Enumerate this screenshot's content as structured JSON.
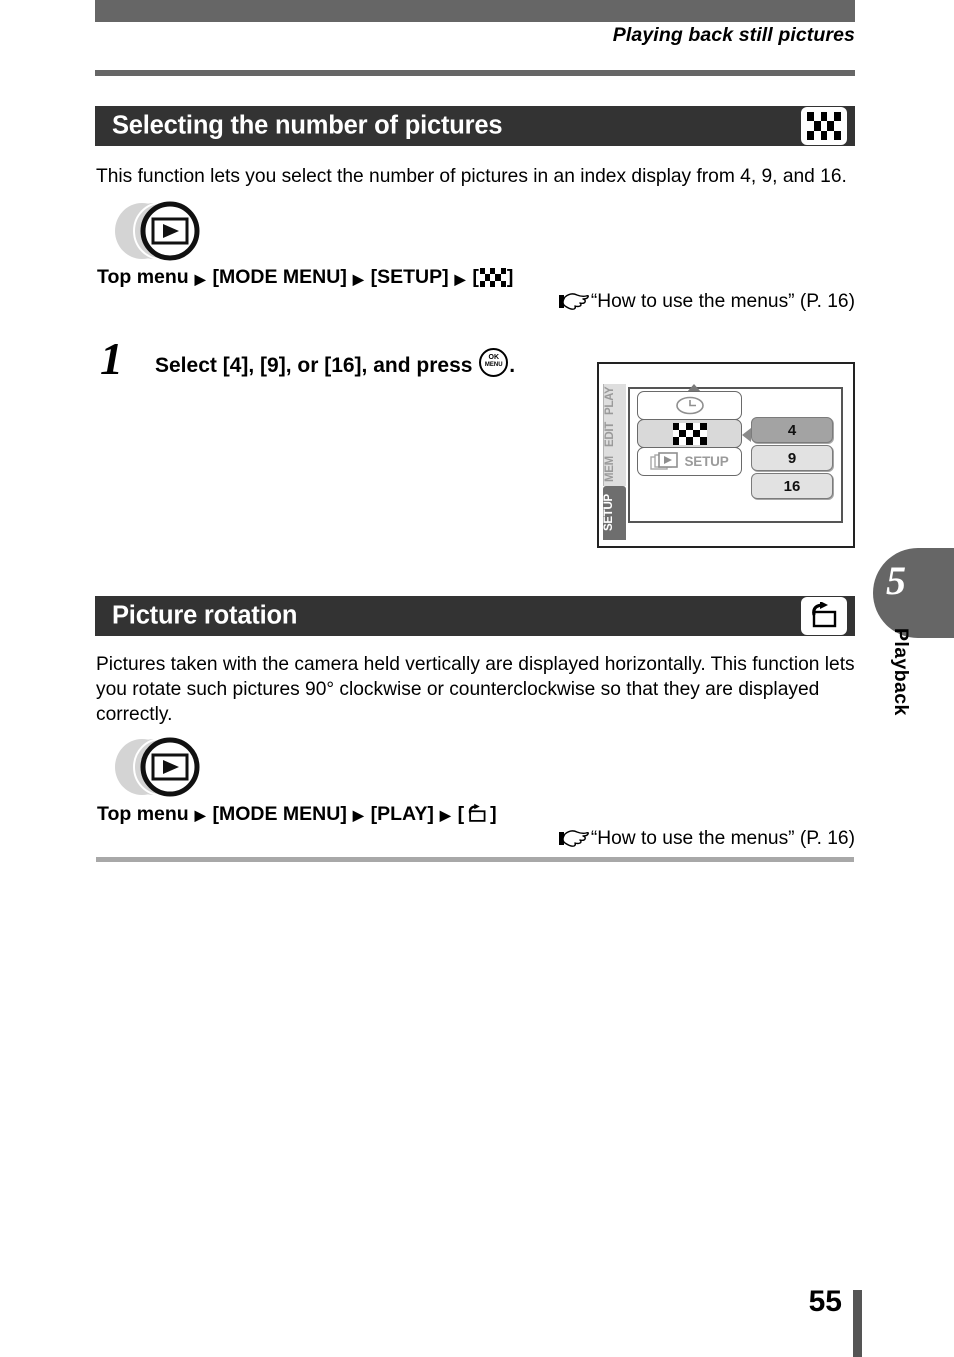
{
  "header": {
    "running_head": "Playing back still pictures"
  },
  "sections": [
    {
      "id": "selecting-number-of-pictures",
      "title": "Selecting the number of pictures",
      "badge_icon": "index-display-icon",
      "intro": "This function lets you select the number of pictures in an index display from 4, 9, and 16.",
      "button_graphic": "playback-button-icon",
      "menu_path": {
        "start": "Top menu",
        "arrow": "▶",
        "item1": "[MODE MENU]",
        "item2": "[SETUP]",
        "item3_prefix": "[",
        "item3_icon": "index-display-icon",
        "item3_suffix": "]"
      },
      "reference": {
        "hand_icon": "pointing-hand-icon",
        "text": "“How to use the menus” (P. 16)"
      },
      "step": {
        "number": "1",
        "text_before": "Select [4], [9], or [16], and press ",
        "ok_label": "OK",
        "menu_label": "MENU",
        "text_after": "."
      }
    },
    {
      "id": "picture-rotation",
      "title": "Picture rotation",
      "badge_icon": "picture-rotation-icon",
      "intro": "Pictures taken with the camera held vertically are displayed horizontally. This function lets you rotate such pictures 90° clockwise or counterclockwise so that they are displayed correctly.",
      "button_graphic": "playback-button-icon",
      "menu_path": {
        "start": "Top menu",
        "arrow": "▶",
        "item1": "[MODE MENU]",
        "item2": "[PLAY]",
        "item3_prefix": "[",
        "item3_icon": "picture-rotation-icon",
        "item3_suffix": "]"
      },
      "reference": {
        "hand_icon": "pointing-hand-icon",
        "text": "“How to use the menus” (P. 16)"
      }
    }
  ],
  "lcd_screen": {
    "tabs": [
      {
        "label": "PLAY",
        "active": false
      },
      {
        "label": "EDIT",
        "active": false
      },
      {
        "label": "MEM",
        "active": false
      },
      {
        "label": "SETUP",
        "active": true
      }
    ],
    "menu_items": [
      {
        "icon": "clock-icon",
        "label": "",
        "selected": false
      },
      {
        "icon": "index-display-icon",
        "label": "",
        "selected": true
      },
      {
        "icon": "setup-playback-icon",
        "label": "SETUP",
        "selected": false
      }
    ],
    "values": [
      {
        "label": "4",
        "highlighted": true
      },
      {
        "label": "9",
        "highlighted": false
      },
      {
        "label": "16",
        "highlighted": false
      }
    ]
  },
  "chapter_tab": {
    "number": "5",
    "label": "Playback"
  },
  "footer": {
    "page_number": "55"
  },
  "colors": {
    "header_bar": "#666666",
    "section_bar": "#333333",
    "rule": "#a8a8a8",
    "tab_active": "#6e6e6e",
    "value_highlight": "#a3a3a3"
  }
}
